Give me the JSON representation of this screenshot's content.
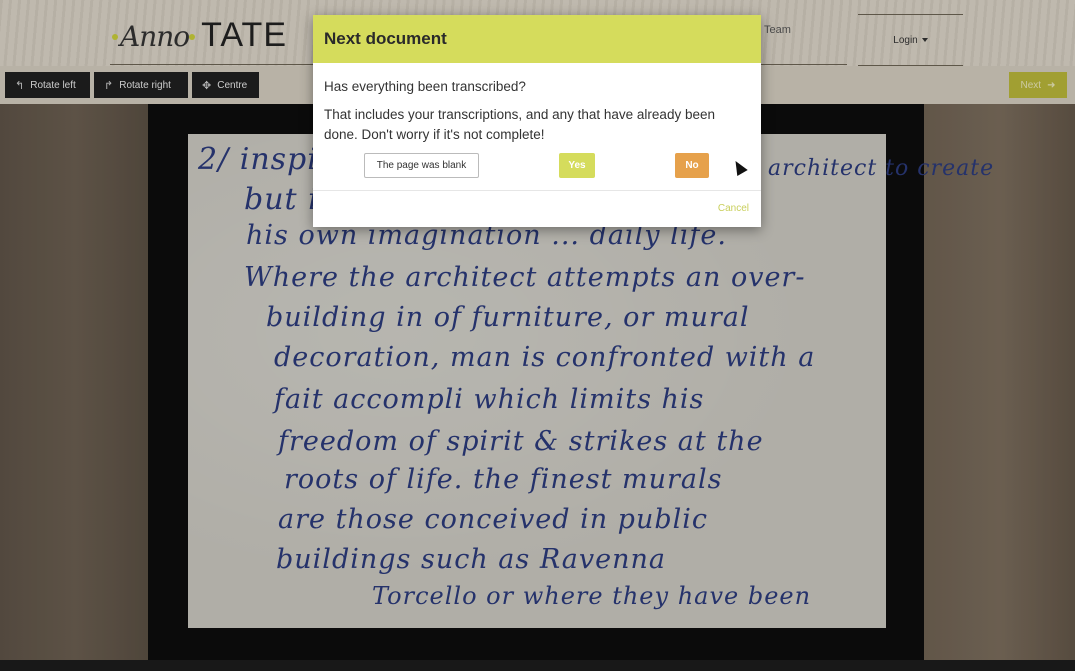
{
  "header": {
    "logo_anno": "Anno",
    "logo_tate": "TATE",
    "nav_team": "Team",
    "login_label": "Login"
  },
  "toolbar": {
    "rotate_left": "Rotate left",
    "rotate_right": "Rotate right",
    "centre": "Centre",
    "next": "Next"
  },
  "document": {
    "lines": [
      "2/ inspir",
      "but is",
      "his own imagination ... daily life.",
      "Where the architect attempts an over-",
      "building in of furniture, or  mural",
      "decoration, man is confronted with a",
      "fait accompli which limits  his",
      "freedom of spirit & strikes at the",
      "roots of life.  the finest murals",
      "are those conceived in public",
      "buildings such as Ravenna",
      "Torcello or where they have been"
    ],
    "top_right": "architect to create"
  },
  "modal": {
    "title": "Next document",
    "question": "Has everything been transcribed?",
    "explanation": "That includes your transcriptions, and any that have already been done. Don't worry if it's not complete!",
    "blank_label": "The page was blank",
    "yes_label": "Yes",
    "no_label": "No",
    "cancel_label": "Cancel"
  },
  "colors": {
    "accent": "#d5dc5c",
    "no_button": "#e6a14b",
    "ink": "#2b3a7a"
  }
}
